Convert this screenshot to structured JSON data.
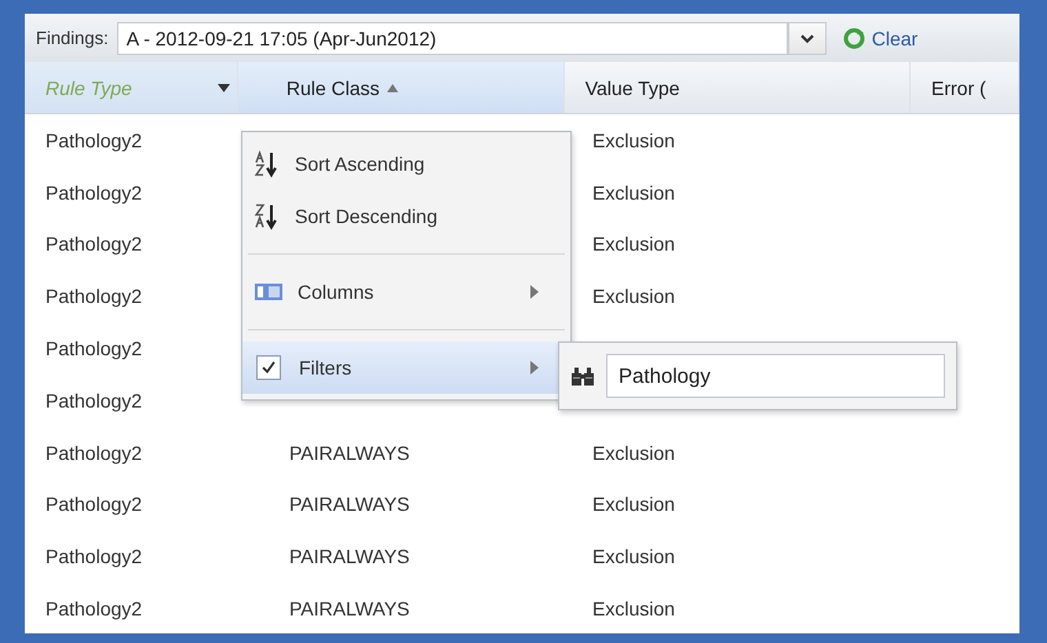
{
  "toolbar": {
    "label": "Findings:",
    "combo_value": "A - 2012-09-21 17:05 (Apr-Jun2012)",
    "clear_button": "Clear"
  },
  "table": {
    "columns": [
      {
        "label": "Rule Type",
        "filtered": true,
        "sorted_ascending": false,
        "menu_open": true
      },
      {
        "label": "Rule Class",
        "filtered": false,
        "sorted_ascending": true,
        "menu_open": false
      },
      {
        "label": "Value Type",
        "filtered": false,
        "sorted_ascending": false,
        "menu_open": false
      },
      {
        "label": "Error (",
        "filtered": false,
        "sorted_ascending": false,
        "menu_open": false
      }
    ],
    "rows": [
      {
        "cells": [
          "Pathology2",
          null,
          "Exclusion"
        ]
      },
      {
        "cells": [
          "Pathology2",
          null,
          "Exclusion"
        ]
      },
      {
        "cells": [
          "Pathology2",
          null,
          "Exclusion"
        ]
      },
      {
        "cells": [
          "Pathology2",
          null,
          "Exclusion"
        ]
      },
      {
        "cells": [
          "Pathology2",
          null,
          null
        ]
      },
      {
        "cells": [
          "Pathology2",
          null,
          null
        ]
      },
      {
        "cells": [
          "Pathology2",
          "PAIRALWAYS",
          "Exclusion"
        ]
      },
      {
        "cells": [
          "Pathology2",
          "PAIRALWAYS",
          "Exclusion"
        ]
      },
      {
        "cells": [
          "Pathology2",
          "PAIRALWAYS",
          "Exclusion"
        ]
      },
      {
        "cells": [
          "Pathology2",
          "PAIRALWAYS",
          "Exclusion"
        ]
      }
    ]
  },
  "column_menu": {
    "items": [
      {
        "kind": "sort-asc",
        "label": "Sort Ascending",
        "selected": false,
        "submenu": false
      },
      {
        "kind": "sort-desc",
        "label": "Sort Descending",
        "selected": false,
        "submenu": false
      },
      {
        "kind": "separator"
      },
      {
        "kind": "columns",
        "label": "Columns",
        "selected": false,
        "submenu": true
      },
      {
        "kind": "separator"
      },
      {
        "kind": "check",
        "label": "Filters",
        "checked": true,
        "selected": true,
        "submenu": true
      }
    ]
  },
  "filter_submenu": {
    "value": "Pathology"
  }
}
